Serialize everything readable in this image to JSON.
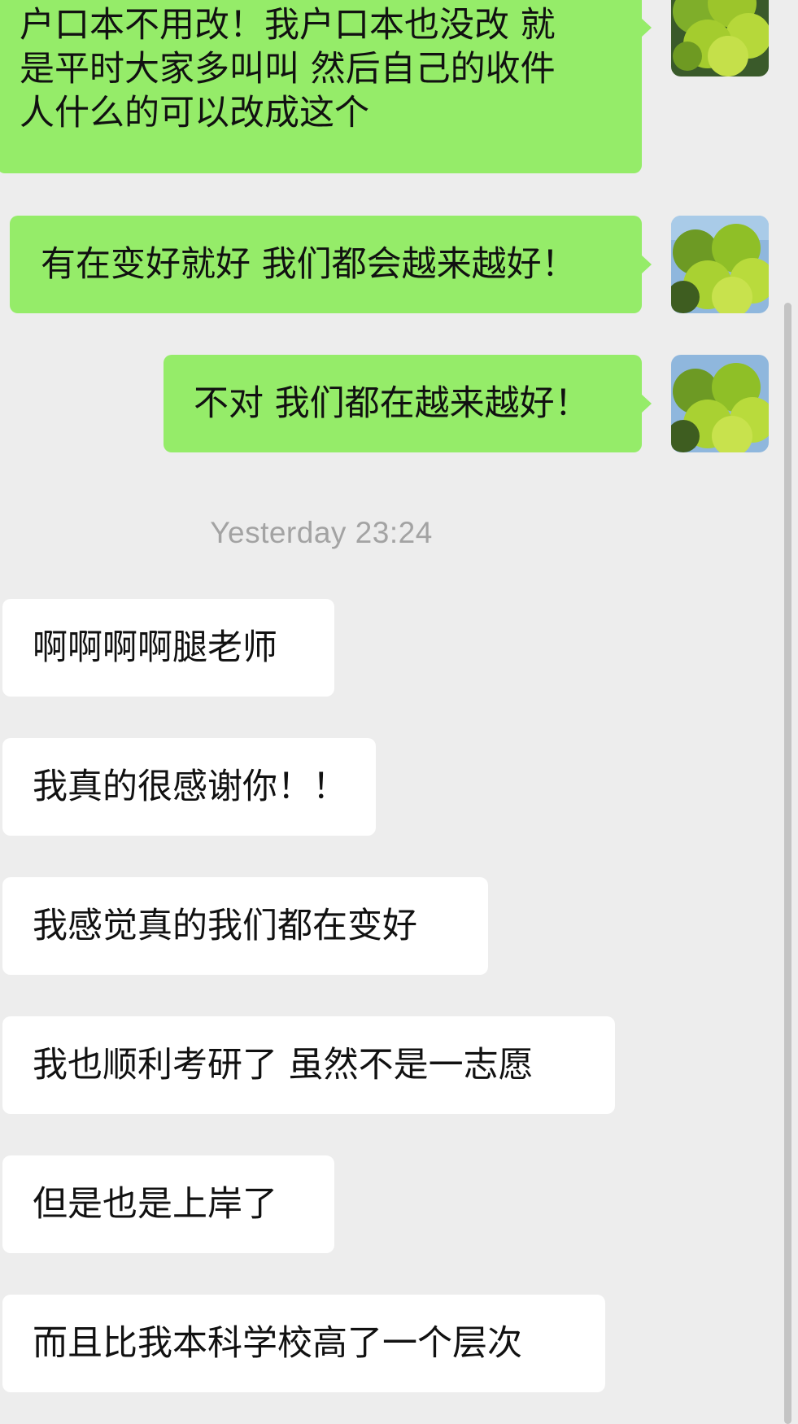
{
  "messages_out": [
    {
      "lines": [
        "户口本不用改！我户口本也没改 就",
        "是平时大家多叫叫 然后自己的收件",
        "人什么的可以改成这个"
      ]
    },
    {
      "text": "有在变好就好 我们都会越来越好！"
    },
    {
      "text": "不对 我们都在越来越好！"
    }
  ],
  "timestamp": "Yesterday 23:24",
  "messages_in": [
    {
      "text": "啊啊啊啊腿老师"
    },
    {
      "text": "我真的很感谢你！！"
    },
    {
      "text": "我感觉真的我们都在变好"
    },
    {
      "text": "我也顺利考研了 虽然不是一志愿"
    },
    {
      "text": "但是也是上岸了"
    },
    {
      "text": "而且比我本科学校高了一个层次"
    }
  ],
  "colors": {
    "background": "#ededed",
    "outgoing_bubble": "#95ec69",
    "incoming_bubble": "#ffffff",
    "timestamp_text": "#a3a3a3",
    "scrollbar_thumb": "#c4c4c4"
  },
  "avatar_icon": "tree-foliage-avatar"
}
